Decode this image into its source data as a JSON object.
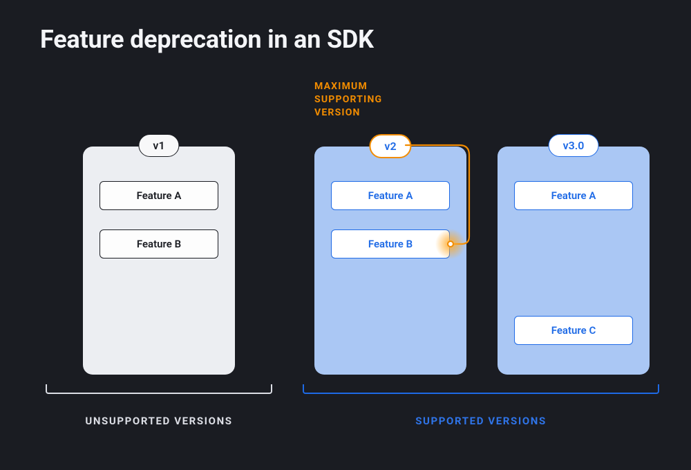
{
  "title": "Feature deprecation in an SDK",
  "annotation": {
    "line1": "MAXIMUM",
    "line2": "SUPPORTING",
    "line3": "VERSION"
  },
  "versions": {
    "v1": {
      "label": "v1",
      "featureA": "Feature A",
      "featureB": "Feature B"
    },
    "v2": {
      "label": "v2",
      "featureA": "Feature A",
      "featureB": "Feature B"
    },
    "v3": {
      "label": "v3.0",
      "featureA": "Feature A",
      "featureC": "Feature C"
    }
  },
  "groups": {
    "unsupported": "UNSUPPORTED VERSIONS",
    "supported": "SUPPORTED VERSIONS"
  },
  "colors": {
    "background": "#1a1c22",
    "accentBlue": "#1e6ae6",
    "accentOrange": "#F28C00",
    "cardBlue": "#aac7f4",
    "cardLight": "#eceef2"
  }
}
